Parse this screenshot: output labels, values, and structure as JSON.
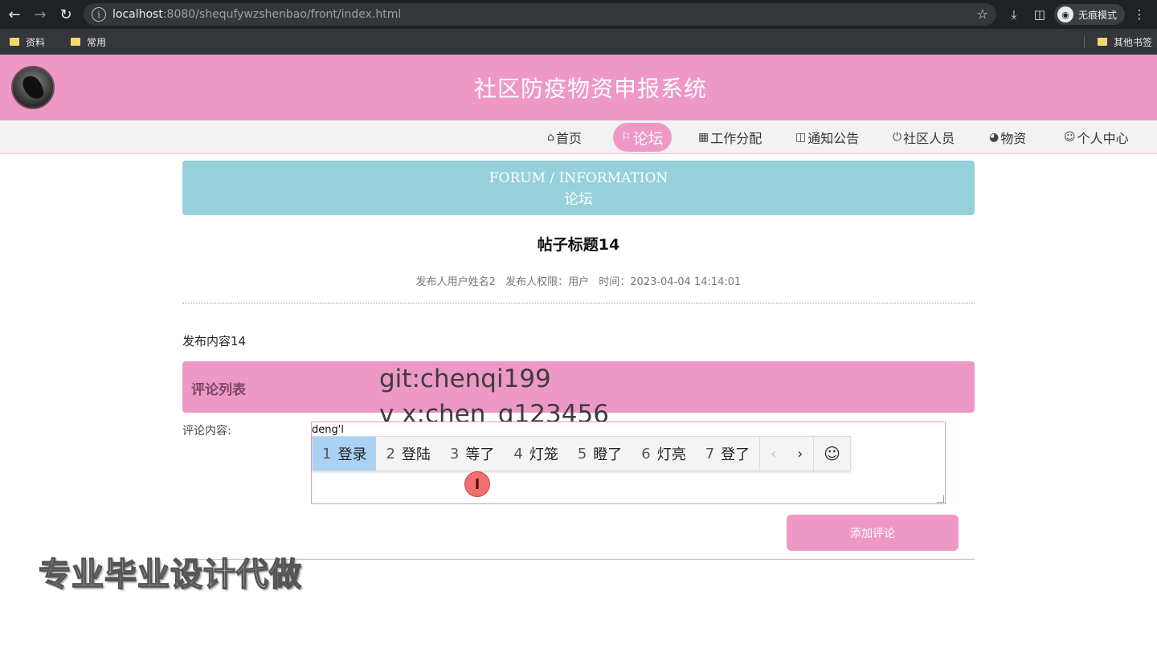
{
  "browser": {
    "url_host": "localhost",
    "url_rest": ":8080/shequfywzshenbao/front/index.html",
    "incognito_label": "无痕模式",
    "bookmarks": [
      "资料",
      "常用"
    ],
    "other_bookmarks": "其他书签"
  },
  "site": {
    "title": "社区防疫物资申报系统"
  },
  "menu": {
    "items": [
      {
        "label": "首页",
        "icon": "home-icon"
      },
      {
        "label": "论坛",
        "icon": "flag-icon",
        "active": true
      },
      {
        "label": "工作分配",
        "icon": "grid-icon"
      },
      {
        "label": "通知公告",
        "icon": "reader-icon"
      },
      {
        "label": "社区人员",
        "icon": "power-icon"
      },
      {
        "label": "物资",
        "icon": "gamepad-icon"
      },
      {
        "label": "个人中心",
        "icon": "user-icon"
      }
    ]
  },
  "banner": {
    "en": "FORUM / INFORMATION",
    "cn": "论坛"
  },
  "post": {
    "title": "帖子标题14",
    "author": "发布人用户姓名2",
    "role": "发布人权限：用户",
    "time": "时间：2023-04-04 14:14:01",
    "content": "发布内容14"
  },
  "comments": {
    "header": "评论列表",
    "input_label": "评论内容:",
    "input_value": "deng'l",
    "submit_label": "添加评论"
  },
  "ime": {
    "candidates": [
      {
        "num": "1",
        "text": "登录"
      },
      {
        "num": "2",
        "text": "登陆"
      },
      {
        "num": "3",
        "text": "等了"
      },
      {
        "num": "4",
        "text": "灯笼"
      },
      {
        "num": "5",
        "text": "瞪了"
      },
      {
        "num": "6",
        "text": "灯亮"
      },
      {
        "num": "7",
        "text": "登了"
      }
    ]
  },
  "overlay": {
    "line1": "git:chenqi199",
    "line2": "v x:chen_q123456",
    "caption": "专业毕业设计代做"
  },
  "colors": {
    "brand_pink": "#ee98c6",
    "banner_teal": "#96d1db",
    "ime_selected": "#a9d2f5"
  }
}
